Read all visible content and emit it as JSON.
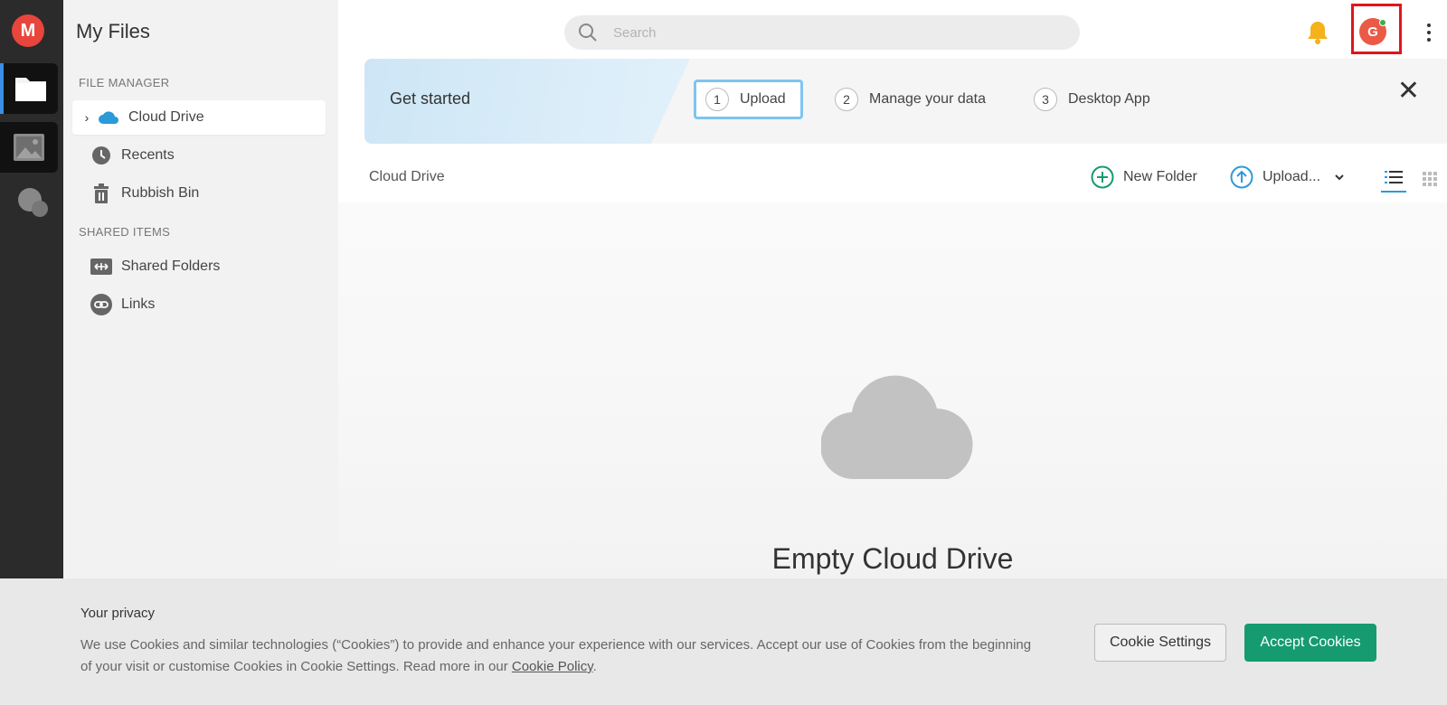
{
  "app": {
    "logo_letter": "M",
    "page_title": "My Files"
  },
  "rail": {
    "items": [
      {
        "name": "files",
        "icon": "folder-icon"
      },
      {
        "name": "photos",
        "icon": "image-icon"
      },
      {
        "name": "chat",
        "icon": "chat-icon"
      }
    ]
  },
  "sidebar": {
    "file_manager_label": "FILE MANAGER",
    "shared_items_label": "SHARED ITEMS",
    "items": [
      {
        "label": "Cloud Drive",
        "icon": "cloud-icon"
      },
      {
        "label": "Recents",
        "icon": "clock-icon"
      },
      {
        "label": "Rubbish Bin",
        "icon": "trash-icon"
      },
      {
        "label": "Shared Folders",
        "icon": "shared-folder-icon"
      },
      {
        "label": "Links",
        "icon": "link-icon"
      }
    ]
  },
  "search": {
    "placeholder": "Search"
  },
  "header": {
    "avatar_letter": "G"
  },
  "banner": {
    "title": "Get started",
    "steps": [
      {
        "num": "1",
        "label": "Upload"
      },
      {
        "num": "2",
        "label": "Manage your data"
      },
      {
        "num": "3",
        "label": "Desktop App"
      }
    ],
    "close": "✕"
  },
  "toolbar": {
    "breadcrumb": "Cloud Drive",
    "new_folder": "New Folder",
    "upload": "Upload..."
  },
  "content": {
    "empty_title": "Empty Cloud Drive"
  },
  "cookie": {
    "title": "Your privacy",
    "text": "We use Cookies and similar technologies (“Cookies”) to provide and enhance your experience with our services. Accept our use of Cookies from the beginning of your visit or customise Cookies in Cookie Settings. Read more in our ",
    "policy_link": "Cookie Policy",
    "text_end": ".",
    "settings_button": "Cookie Settings",
    "accept_button": "Accept Cookies"
  },
  "colors": {
    "brand_red": "#e8453c",
    "accent_blue": "#2f9ad8",
    "accept_green": "#159b6f",
    "highlight_red": "#e0161b"
  }
}
